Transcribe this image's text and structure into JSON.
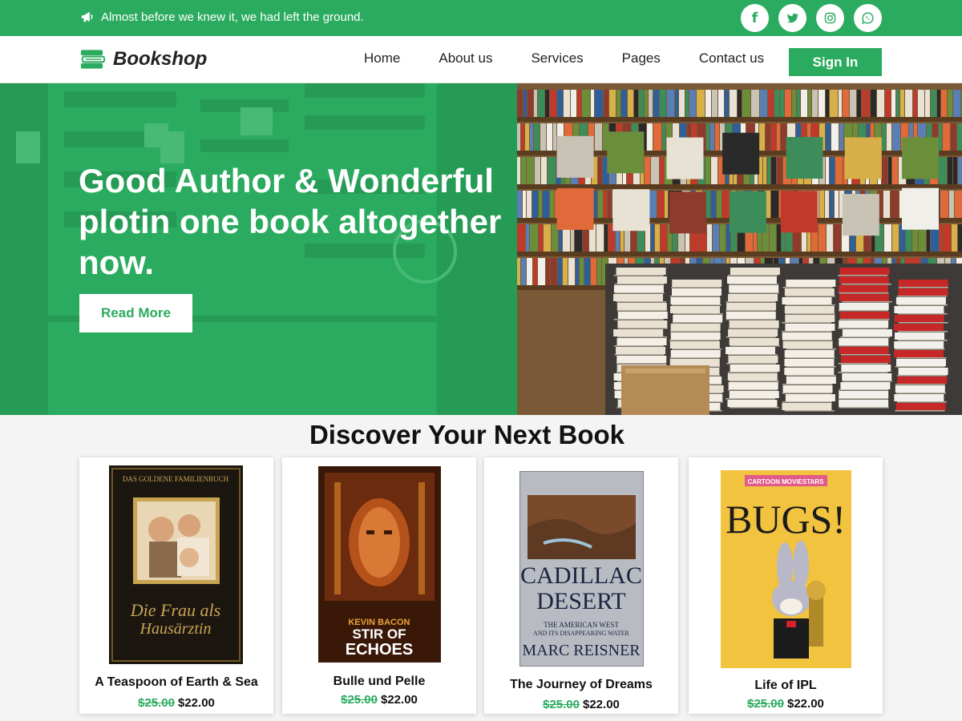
{
  "topbar": {
    "announcement": "Almost before we knew it, we had left the ground.",
    "socials": [
      "facebook",
      "twitter",
      "instagram",
      "whatsapp"
    ]
  },
  "nav": {
    "brand": "Bookshop",
    "links": [
      "Home",
      "About us",
      "Services",
      "Pages",
      "Contact us"
    ],
    "signin": "Sign In"
  },
  "hero": {
    "title": "Good Author & Wonderful plotin one book altogether now.",
    "button": "Read More"
  },
  "section": {
    "title": "Discover Your Next Book",
    "books": [
      {
        "name": "A Teaspoon of Earth & Sea",
        "old_price": "$25.00",
        "price": "$22.00",
        "cover_text": [
          "DAS GOLDENE FAMILIENBUCH",
          "Die Frau als",
          "Hausärztin"
        ]
      },
      {
        "name": "Bulle und Pelle",
        "old_price": "$25.00",
        "price": "$22.00",
        "cover_text": [
          "KEVIN BACON",
          "STIR OF",
          "ECHOES"
        ]
      },
      {
        "name": "The Journey of Dreams",
        "old_price": "$25.00",
        "price": "$22.00",
        "cover_text": [
          "CADILLAC",
          "DESERT",
          "THE AMERICAN WEST",
          "AND ITS DISAPPEARING WATER",
          "MARC REISNER"
        ]
      },
      {
        "name": "Life of IPL",
        "old_price": "$25.00",
        "price": "$22.00",
        "cover_text": [
          "CARTOON MOVIESTARS",
          "BUGS!"
        ]
      }
    ]
  },
  "colors": {
    "accent": "#2bab5f",
    "text": "#111111",
    "page_bg": "#f4f4f4"
  }
}
